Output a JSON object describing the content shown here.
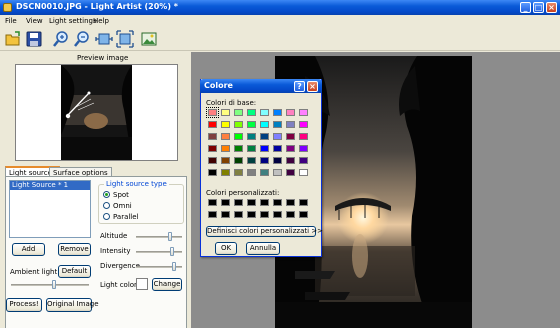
{
  "window": {
    "title": "DSCN0010.JPG - Light Artist (20%) *",
    "minimize": "_",
    "maximize": "□",
    "close": "×"
  },
  "menu": [
    "File",
    "View",
    "Light settings",
    "Help"
  ],
  "toolbar": {
    "icons": [
      "open-icon",
      "save-icon",
      "zoom-in-icon",
      "zoom-out-icon",
      "fit-width-icon",
      "fit-window-icon",
      "show-image-icon"
    ]
  },
  "left": {
    "preview_label": "Preview image",
    "tabs": [
      "Light sources",
      "Surface options"
    ],
    "light_sources": [
      "Light Source * 1"
    ],
    "type_group": {
      "legend": "Light source type",
      "options": [
        "Spot",
        "Omni",
        "Parallel"
      ],
      "selected": "Spot"
    },
    "add": "Add",
    "remove": "Remove",
    "ambient_label": "Ambient light",
    "ambient_default": "Default",
    "ambient_level": 0.55,
    "sliders": [
      {
        "label": "Altitude",
        "level": 0.75
      },
      {
        "label": "Intensity",
        "level": 0.8
      },
      {
        "label": "Divergence",
        "level": 0.85
      }
    ],
    "light_color_label": "Light color",
    "light_color": "#ffffff",
    "change": "Change",
    "process": "Process!",
    "original": "Original Image"
  },
  "dialog": {
    "title": "Colore",
    "help": "?",
    "close": "×",
    "basic_label": "Colori di base:",
    "basic_colors": [
      [
        "#ff8080",
        "#ffff80",
        "#80ff80",
        "#00ff80",
        "#80ffff",
        "#0080ff",
        "#ff80c0",
        "#ff80ff"
      ],
      [
        "#ff0000",
        "#ffff00",
        "#80ff00",
        "#00ff40",
        "#00ffff",
        "#0080c0",
        "#8080c0",
        "#ff00ff"
      ],
      [
        "#804040",
        "#ff8040",
        "#00ff00",
        "#008080",
        "#004080",
        "#8080ff",
        "#800040",
        "#ff0080"
      ],
      [
        "#800000",
        "#ff8000",
        "#008000",
        "#008040",
        "#0000ff",
        "#0000a0",
        "#800080",
        "#8000ff"
      ],
      [
        "#400000",
        "#804000",
        "#004000",
        "#004040",
        "#000080",
        "#000040",
        "#400040",
        "#400080"
      ],
      [
        "#000000",
        "#808000",
        "#808040",
        "#808080",
        "#408080",
        "#c0c0c0",
        "#400040",
        "#ffffff"
      ]
    ],
    "selected_color": "#ff8080",
    "custom_label": "Colori personalizzati:",
    "custom_colors": [
      [
        "#000000",
        "#000000",
        "#000000",
        "#000000",
        "#000000",
        "#000000",
        "#000000",
        "#000000"
      ],
      [
        "#000000",
        "#000000",
        "#000000",
        "#000000",
        "#000000",
        "#000000",
        "#000000",
        "#000000"
      ]
    ],
    "define_custom": "Definisci colori personalizzati >>",
    "ok": "OK",
    "cancel": "Annulla"
  }
}
